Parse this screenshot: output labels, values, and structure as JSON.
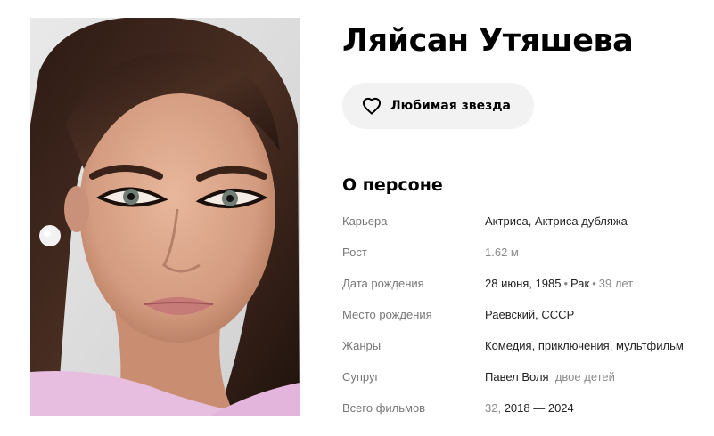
{
  "person": {
    "name": "Ляйсан Утяшева",
    "favorite_button_label": "Любимая звезда",
    "about_title": "О персоне"
  },
  "facts": {
    "career": {
      "label": "Карьера",
      "value_1": "Актриса",
      "sep": ", ",
      "value_2": "Актриса дубляжа"
    },
    "height": {
      "label": "Рост",
      "value": "1.62 м"
    },
    "birth_date": {
      "label": "Дата рождения",
      "date": "28 июня, 1985",
      "sep1": "•",
      "sign": "Рак",
      "sep2": "•",
      "age": "39 лет"
    },
    "birth_place": {
      "label": "Место рождения",
      "city": "Раевский",
      "sep": ", ",
      "country": "СССР"
    },
    "genres": {
      "label": "Жанры",
      "g1": "Комедия",
      "sep1": ", ",
      "g2": "приключения",
      "sep2": ", ",
      "g3": "мультфильм"
    },
    "spouse": {
      "label": "Супруг",
      "name": "Павел Воля",
      "note": "двое детей"
    },
    "total_films": {
      "label": "Всего фильмов",
      "count": "32",
      "sep": ", ",
      "range": "2018 — 2024"
    }
  },
  "colors": {
    "button_bg": "#f2f2f2",
    "label_gray": "#777777",
    "text_dark": "#1f1f1f"
  },
  "icons": {
    "favorite": "heart-icon"
  }
}
